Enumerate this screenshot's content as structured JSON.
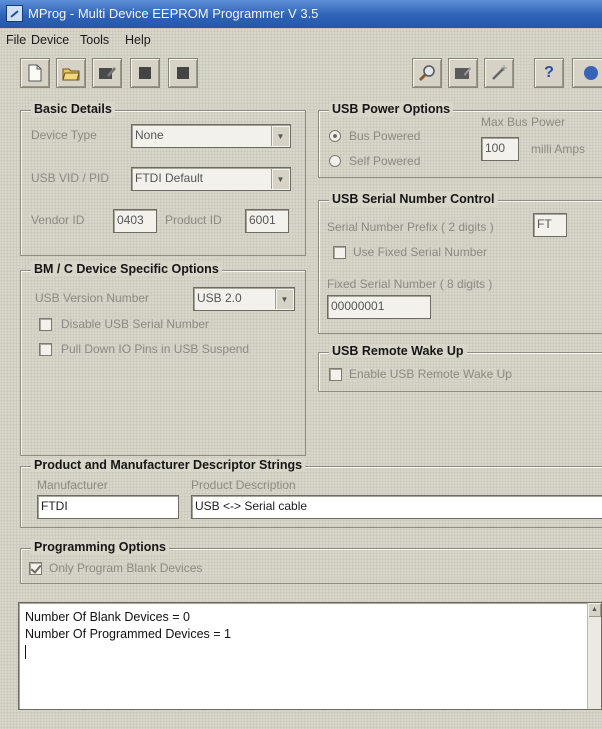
{
  "window": {
    "title": "MProg - Multi Device EEPROM Programmer V 3.5"
  },
  "menu": [
    "File",
    "Device",
    "Tools",
    "Help"
  ],
  "toolbar": {
    "left_icons": [
      "new-file-icon",
      "open-folder-icon",
      "edit-icon",
      "program-chip-icon",
      "erase-chip-icon"
    ],
    "right_icons": [
      "search-icon",
      "read-device-icon",
      "wand-icon",
      "help-icon"
    ],
    "help_glyph": "?"
  },
  "basic_details": {
    "title": "Basic Details",
    "device_type_label": "Device Type",
    "device_type_value": "None",
    "vid_pid_label": "USB VID / PID",
    "vid_pid_value": "FTDI Default",
    "vendor_id_label": "Vendor ID",
    "vendor_id_value": "0403",
    "product_id_label": "Product ID",
    "product_id_value": "6001"
  },
  "bm_options": {
    "title": "BM / C Device Specific Options",
    "usb_version_label": "USB Version Number",
    "usb_version_value": "USB 2.0",
    "disable_serial_label": "Disable USB Serial Number",
    "disable_serial_checked": false,
    "pull_down_label": "Pull Down IO Pins in USB Suspend",
    "pull_down_checked": false
  },
  "usb_power": {
    "title": "USB Power Options",
    "bus_powered_label": "Bus Powered",
    "bus_powered_selected": true,
    "self_powered_label": "Self Powered",
    "self_powered_selected": false,
    "max_bus_power_label": "Max Bus Power",
    "max_bus_power_value": "100",
    "milli_amps_label": "milli Amps"
  },
  "serial_control": {
    "title": "USB Serial Number Control",
    "prefix_label": "Serial Number Prefix ( 2 digits )",
    "prefix_value": "FT",
    "use_fixed_label": "Use Fixed Serial Number",
    "use_fixed_checked": false,
    "fixed_serial_label": "Fixed Serial Number ( 8 digits )",
    "fixed_serial_value": "00000001"
  },
  "remote_wake": {
    "title": "USB Remote Wake Up",
    "enable_label": "Enable USB Remote Wake Up",
    "enable_checked": false
  },
  "descriptor_strings": {
    "title": "Product and Manufacturer Descriptor Strings",
    "manufacturer_label": "Manufacturer",
    "manufacturer_value": "FTDI",
    "product_desc_label": "Product Description",
    "product_desc_value": "USB <-> Serial cable"
  },
  "programming_options": {
    "title": "Programming Options",
    "only_blank_label": "Only Program Blank Devices",
    "only_blank_checked": true
  },
  "log": {
    "lines": [
      "Number Of Blank Devices = 0",
      "Number Of Programmed Devices = 1"
    ]
  },
  "colors": {
    "titlebar": "#2f63b8",
    "face": "#d8d5c9",
    "disabled_text": "#8c8a80"
  }
}
